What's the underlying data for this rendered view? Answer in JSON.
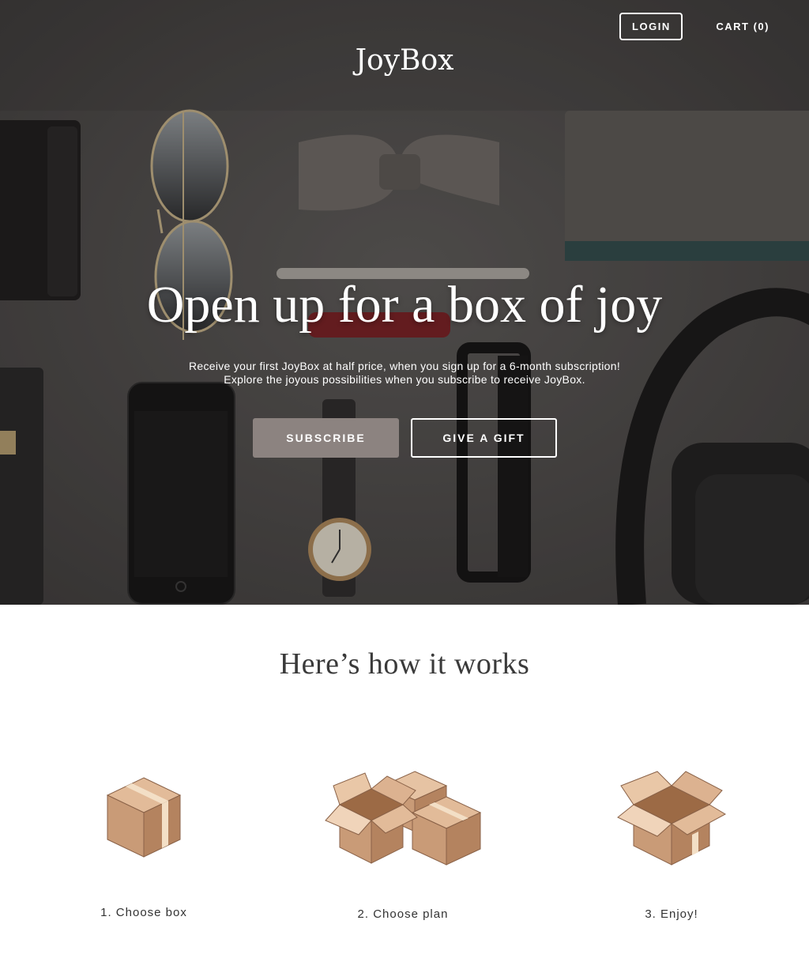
{
  "nav": {
    "login_label": "LOGIN",
    "cart_label": "CART (0)"
  },
  "brand": {
    "logo": "JoyBox"
  },
  "hero": {
    "headline": "Open up for a box of joy",
    "subtext_line1": "Receive your first JoyBox at half price, when you sign up for a 6-month subscription!",
    "subtext_line2": "Explore the joyous possibilities when you subscribe to receive JoyBox.",
    "subscribe_label": "SUBSCRIBE",
    "gift_label": "GIVE A GIFT"
  },
  "how": {
    "title": "Here’s how it works",
    "steps": [
      {
        "label": "1. Choose box",
        "icon": "closed-box-icon"
      },
      {
        "label": "2. Choose plan",
        "icon": "multiple-boxes-icon"
      },
      {
        "label": "3. Enjoy!",
        "icon": "open-box-icon"
      }
    ]
  },
  "colors": {
    "subscribe_button": "#8c8380",
    "box_light": "#e2b994",
    "box_dark": "#b8845f"
  }
}
